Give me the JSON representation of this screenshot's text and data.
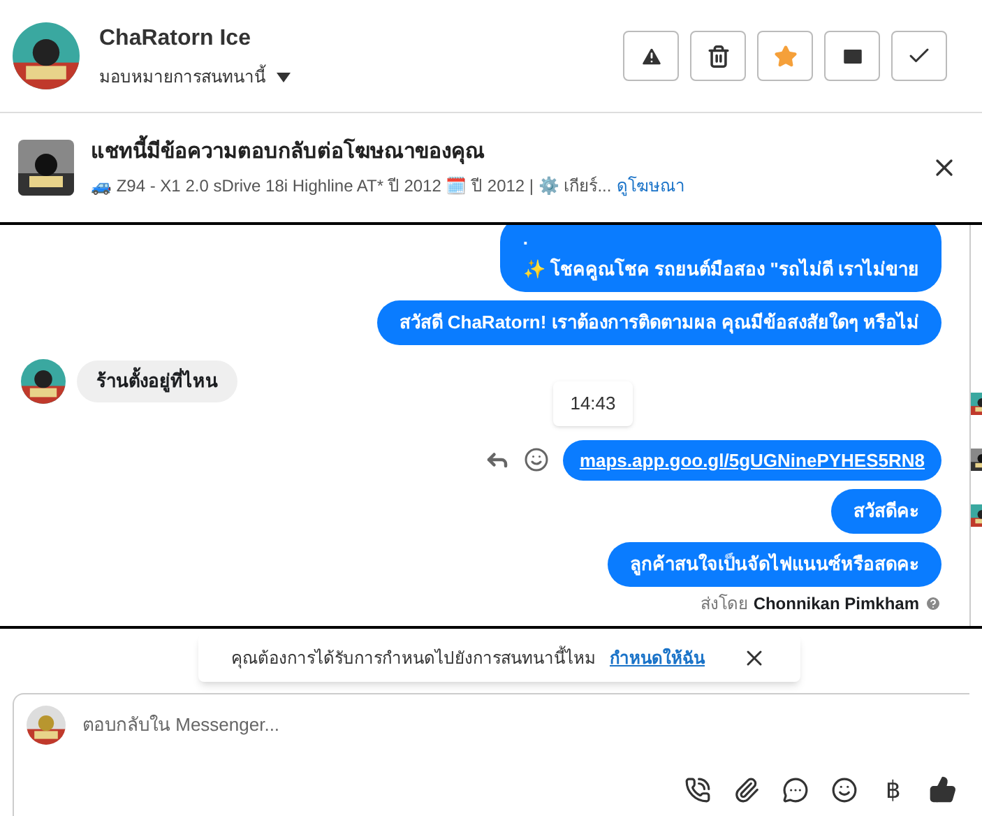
{
  "header": {
    "name": "ChaRatorn Ice",
    "assign_label": "มอบหมายการสนทนานี้",
    "starred": true
  },
  "ad": {
    "title": "แชทนี้มีข้อความตอบกลับต่อโฆษณาของคุณ",
    "details": "🚙 Z94 - X1 2.0 sDrive 18i Highline AT* ปี 2012 🗓️ ปี 2012 | ⚙️ เกียร์...",
    "link": "ดูโฆษณา"
  },
  "messages": [
    {
      "kind": "outgoing",
      "lines": [
        ".",
        "✨ โชคคูณโชค รถยนต์มือสอง \"รถไม่ดี เราไม่ขาย"
      ]
    },
    {
      "kind": "outgoing",
      "lines": [
        "สวัสดี ChaRatorn! เราต้องการติดตามผล คุณมีข้อสงสัยใดๆ หรือไม่"
      ]
    },
    {
      "kind": "incoming",
      "lines": [
        "ร้านตั้งอยู่ที่ไหน"
      ]
    },
    {
      "kind": "time",
      "lines": [
        "14:43"
      ]
    },
    {
      "kind": "link",
      "lines": [
        "maps.app.goo.gl/5gUGNinePYHES5RN8"
      ]
    },
    {
      "kind": "outgoing",
      "lines": [
        "สวัสดีคะ"
      ]
    },
    {
      "kind": "outgoing",
      "lines": [
        "ลูกค้าสนใจเป็นจัดไฟแนนซ์หรือสดคะ"
      ]
    }
  ],
  "sent_by": {
    "label": "ส่งโดย",
    "name": "Chonnikan Pimkham"
  },
  "assign_prompt": {
    "text": "คุณต้องการได้รับการกำหนดไปยังการสนทนานี้ไหม",
    "link": "กำหนดให้ฉัน"
  },
  "composer": {
    "placeholder": "ตอบกลับใน Messenger...",
    "currency_symbol": "฿"
  }
}
